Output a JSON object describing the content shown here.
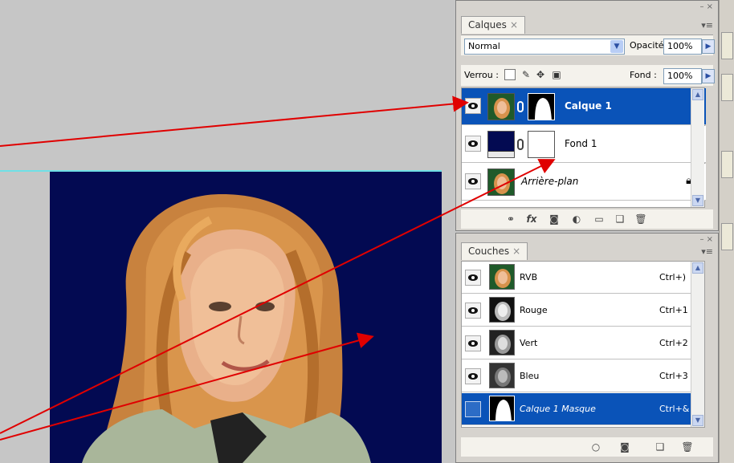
{
  "layers_panel": {
    "tab_label": "Calques",
    "tab_close": "×",
    "blend_mode": "Normal",
    "opacity_label": "Opacité :",
    "opacity_value": "100%",
    "lock_label": "Verrou :",
    "fill_label": "Fond :",
    "fill_value": "100%",
    "layers": [
      {
        "name": "Calque 1",
        "selected": true
      },
      {
        "name": "Fond 1",
        "selected": false
      },
      {
        "name": "Arrière-plan",
        "selected": false
      }
    ]
  },
  "channels_panel": {
    "tab_label": "Couches",
    "tab_close": "×",
    "channels": [
      {
        "name": "RVB",
        "shortcut": "Ctrl+)"
      },
      {
        "name": "Rouge",
        "shortcut": "Ctrl+1"
      },
      {
        "name": "Vert",
        "shortcut": "Ctrl+2"
      },
      {
        "name": "Bleu",
        "shortcut": "Ctrl+3"
      },
      {
        "name": "Calque 1 Masque",
        "shortcut": "Ctrl+&"
      }
    ]
  },
  "colors": {
    "document_background": "#030a52",
    "selection_blue": "#0a53b8",
    "annotation_arrow": "#e00000",
    "guide_line": "#6fe0e6"
  }
}
